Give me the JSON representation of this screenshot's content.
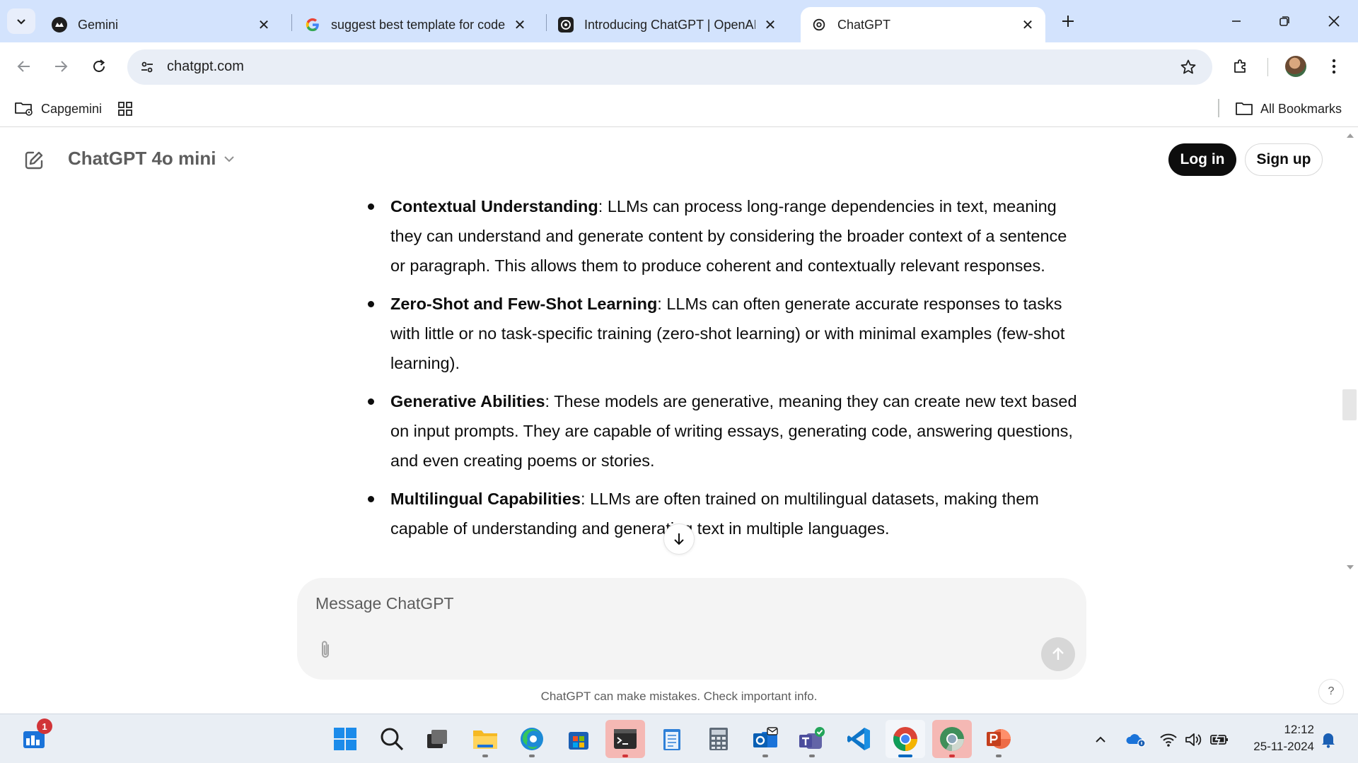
{
  "browser": {
    "tabs": [
      {
        "title": "Gemini",
        "icon": "gemini-icon"
      },
      {
        "title": "suggest best template for code",
        "icon": "google-icon"
      },
      {
        "title": "Introducing ChatGPT | OpenAI",
        "icon": "openai-icon"
      },
      {
        "title": "ChatGPT",
        "icon": "openai-icon",
        "active": true
      }
    ],
    "url": "chatgpt.com",
    "bookmarks": {
      "folder": "Capgemini",
      "all": "All Bookmarks"
    }
  },
  "page": {
    "model": "ChatGPT 4o mini",
    "login_label": "Log in",
    "signup_label": "Sign up",
    "items": [
      {
        "term": "Contextual Understanding",
        "text": ": LLMs can process long-range dependencies in text, meaning they can understand and generate content by considering the broader context of a sentence or paragraph. This allows them to produce coherent and contextually relevant responses."
      },
      {
        "term": "Zero-Shot and Few-Shot Learning",
        "text": ": LLMs can often generate accurate responses to tasks with little or no task-specific training (zero-shot learning) or with minimal examples (few-shot learning)."
      },
      {
        "term": "Generative Abilities",
        "text": ": These models are generative, meaning they can create new text based on input prompts. They are capable of writing essays, generating code, answering questions, and even creating poems or stories."
      },
      {
        "term": "Multilingual Capabilities",
        "text": ": LLMs are often trained on multilingual datasets, making them capable of understanding and generating text in multiple languages."
      }
    ],
    "composer_placeholder": "Message ChatGPT",
    "disclaimer": "ChatGPT can make mistakes. Check important info.",
    "help_label": "?"
  },
  "taskbar": {
    "widgets_badge": "1",
    "time": "12:12",
    "date": "25-11-2024"
  },
  "colors": {
    "tabstrip": "#d3e3fd",
    "omnibox": "#e9eef6",
    "login_bg": "#0d0d0d",
    "composer": "#f4f4f4",
    "taskbar": "#e9eef4"
  }
}
